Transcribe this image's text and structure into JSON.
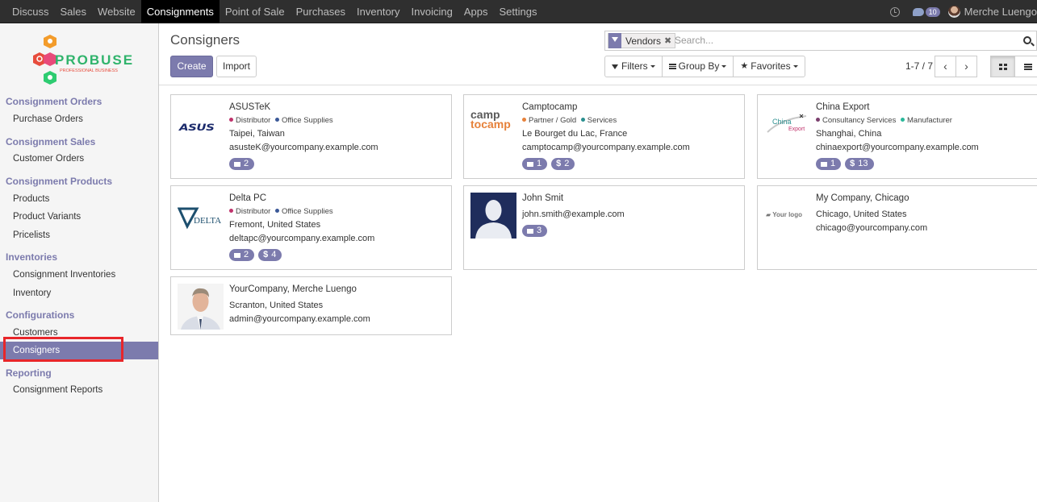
{
  "topbar": {
    "menu": [
      "Discuss",
      "Sales",
      "Website",
      "Consignments",
      "Point of Sale",
      "Purchases",
      "Inventory",
      "Invoicing",
      "Apps",
      "Settings"
    ],
    "active_index": 3,
    "chat_count": "10",
    "user_name": "Merche Luengo"
  },
  "logo": {
    "brand": "PROBUSE",
    "tagline": "PROFESSIONAL BUSINESS"
  },
  "sidebar": {
    "sections": [
      {
        "title": "Consignment Orders",
        "items": [
          "Purchase Orders"
        ]
      },
      {
        "title": "Consignment Sales",
        "items": [
          "Customer Orders"
        ]
      },
      {
        "title": "Consignment Products",
        "items": [
          "Products",
          "Product Variants",
          "Pricelists"
        ]
      },
      {
        "title": "Inventories",
        "items": [
          "Consignment Inventories",
          "Inventory"
        ]
      },
      {
        "title": "Configurations",
        "items": [
          "Customers",
          "Consigners"
        ]
      },
      {
        "title": "Reporting",
        "items": [
          "Consignment Reports"
        ]
      }
    ],
    "active_item": "Consigners"
  },
  "page": {
    "title": "Consigners",
    "create_label": "Create",
    "import_label": "Import",
    "search_facet": "Vendors",
    "search_placeholder": "Search...",
    "filters_label": "Filters",
    "groupby_label": "Group By",
    "favorites_label": "Favorites",
    "pager": "1-7 / 7"
  },
  "cards": [
    {
      "name": "ASUSTeK",
      "logo": "ASUS",
      "tags": [
        {
          "label": "Distributor",
          "color": "#c0336c"
        },
        {
          "label": "Office Supplies",
          "color": "#3b5998"
        }
      ],
      "lines": [
        "Taipei, Taiwan",
        "asusteK@yourcompany.example.com"
      ],
      "badges": [
        {
          "icon": "cart-icon",
          "value": "2"
        }
      ]
    },
    {
      "name": "Camptocamp",
      "logo": "camptocamp",
      "tags": [
        {
          "label": "Partner / Gold",
          "color": "#e6813a"
        },
        {
          "label": "Services",
          "color": "#2a8f8f"
        }
      ],
      "lines": [
        "Le Bourget du Lac, France",
        "camptocamp@yourcompany.example.com"
      ],
      "badges": [
        {
          "icon": "cart-icon",
          "value": "1"
        },
        {
          "icon": "dollar-icon",
          "value": "2"
        }
      ]
    },
    {
      "name": "China Export",
      "logo": "China Export",
      "tags": [
        {
          "label": "Consultancy Services",
          "color": "#7b3f6e"
        },
        {
          "label": "Manufacturer",
          "color": "#2ab89a"
        }
      ],
      "lines": [
        "Shanghai, China",
        "chinaexport@yourcompany.example.com"
      ],
      "badges": [
        {
          "icon": "cart-icon",
          "value": "1"
        },
        {
          "icon": "dollar-icon",
          "value": "13"
        }
      ]
    },
    {
      "name": "Delta PC",
      "logo": "DELTA",
      "tags": [
        {
          "label": "Distributor",
          "color": "#c0336c"
        },
        {
          "label": "Office Supplies",
          "color": "#3b5998"
        }
      ],
      "lines": [
        "Fremont, United States",
        "deltapc@yourcompany.example.com"
      ],
      "badges": [
        {
          "icon": "cart-icon",
          "value": "2"
        },
        {
          "icon": "dollar-icon",
          "value": "4"
        }
      ]
    },
    {
      "name": "John Smit",
      "logo": "",
      "tags": [],
      "lines": [
        "john.smith@example.com"
      ],
      "badges": [
        {
          "icon": "cart-icon",
          "value": "3"
        }
      ]
    },
    {
      "name": "My Company, Chicago",
      "logo": "Your logo",
      "tags": [],
      "lines": [
        "Chicago, United States",
        "chicago@yourcompany.com"
      ],
      "badges": []
    },
    {
      "name": "YourCompany, Merche Luengo",
      "logo": "",
      "tags": [],
      "lines": [
        "Scranton, United States",
        "admin@yourcompany.example.com"
      ],
      "badges": []
    }
  ]
}
